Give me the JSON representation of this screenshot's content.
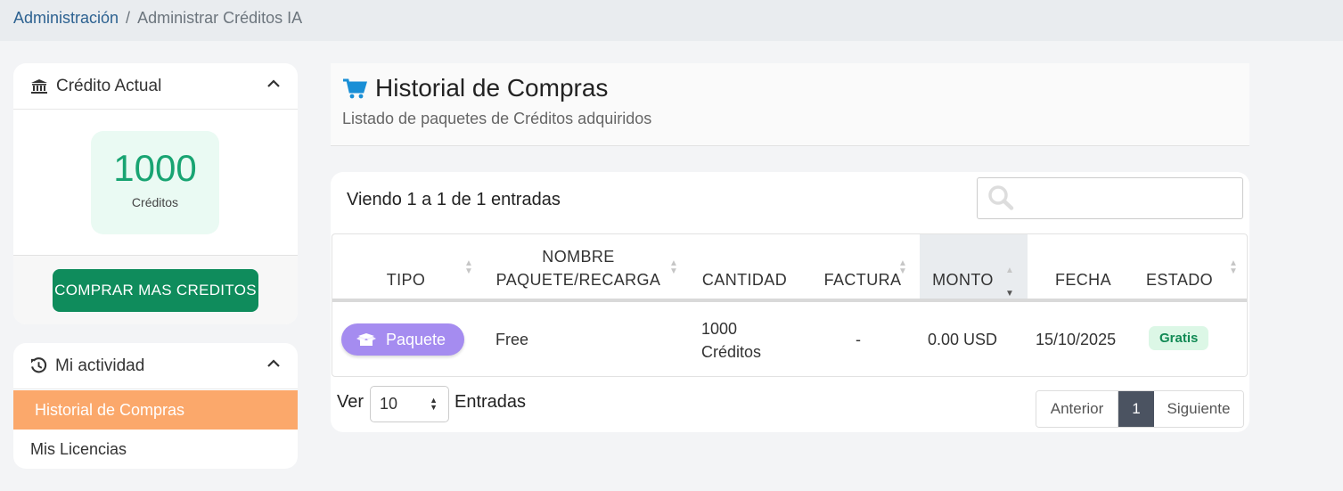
{
  "breadcrumb": {
    "root": "Administración",
    "separator": "/",
    "current": "Administrar Créditos IA"
  },
  "credit_card": {
    "title": "Crédito Actual",
    "amount": "1000",
    "unit_label": "Créditos",
    "buy_button": "COMPRAR MAS CREDITOS"
  },
  "activity_card": {
    "title": "Mi actividad",
    "items": [
      {
        "label": "Historial de Compras",
        "active": true
      },
      {
        "label": "Mis Licencias",
        "active": false
      }
    ]
  },
  "page_header": {
    "title": "Historial de Compras",
    "subtitle": "Listado de paquetes de Créditos adquiridos"
  },
  "table": {
    "viewing_text": "Viendo 1 a 1 de 1 entradas",
    "search_placeholder": "",
    "columns": {
      "tipo": "TIPO",
      "nombre_1": "NOMBRE",
      "nombre_2": "PAQUETE/RECARGA",
      "cantidad": "CANTIDAD",
      "factura": "FACTURA",
      "monto": "MONTO",
      "fecha": "FECHA",
      "estado": "ESTADO"
    },
    "rows": [
      {
        "tipo": "Paquete",
        "nombre": "Free",
        "cantidad_1": "1000",
        "cantidad_2": "Créditos",
        "factura": "-",
        "monto": "0.00 USD",
        "fecha": "15/10/2025",
        "estado": "Gratis"
      }
    ],
    "length_prefix": "Ver",
    "length_value": "10",
    "length_suffix": "Entradas",
    "pagination": {
      "prev": "Anterior",
      "current": "1",
      "next": "Siguiente"
    }
  },
  "colors": {
    "accent_green": "#0f8c5c",
    "active_menu": "#fba86b",
    "pill_purple": "#a58cf0",
    "link_blue": "#2d6291"
  }
}
